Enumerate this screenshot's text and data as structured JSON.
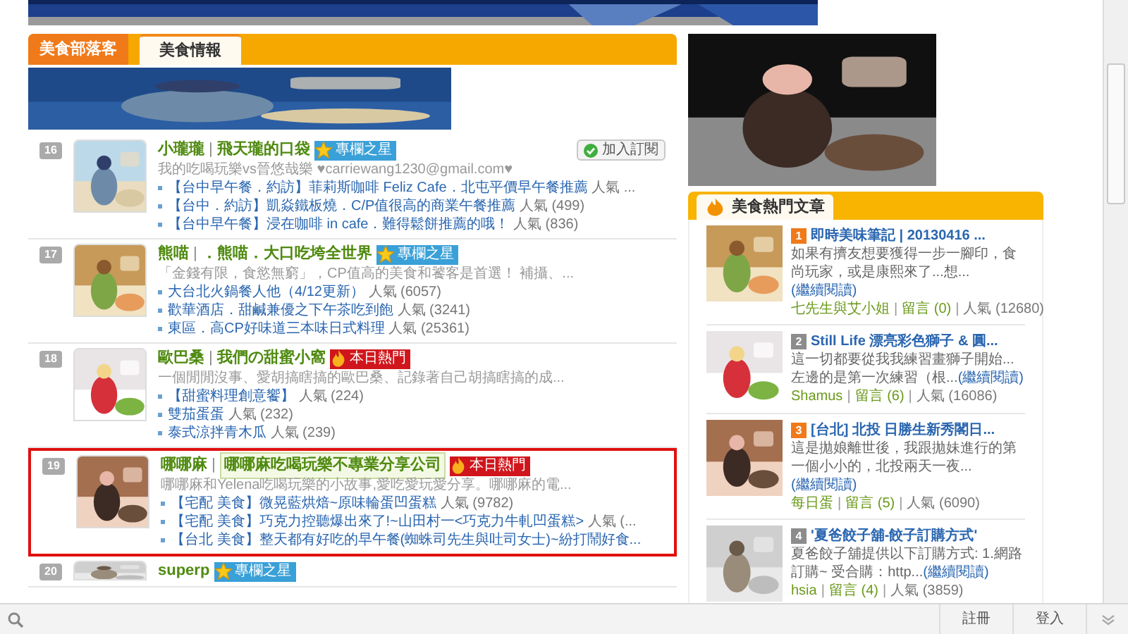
{
  "tabs": [
    {
      "label": "美食部落客",
      "selected": false
    },
    {
      "label": "美食情報",
      "selected": true
    }
  ],
  "blogs": [
    {
      "number": "16",
      "author": "小瓏瓏",
      "blog_name": "飛天瓏的口袋",
      "badge": {
        "kind": "star",
        "label": "專欄之星"
      },
      "subscribe": "加入訂閱",
      "highlighted": false,
      "description": "我的吃喝玩樂vs晉悠哉樂 ♥carriewang1230@gmail.com♥",
      "posts": [
        {
          "title": "【台中早午餐．約訪】菲莉斯咖啡 Feliz Cafe．北屯平價早午餐推薦",
          "popularity": "人氣 ..."
        },
        {
          "title": "【台中．約訪】凱焱鐵板燒．C/P值很高的商業午餐推薦",
          "popularity": "人氣 (499)"
        },
        {
          "title": "【台中早午餐】浸在咖啡 in cafe．難得鬆餅推薦的哦！",
          "popularity": "人氣 (836)"
        }
      ]
    },
    {
      "number": "17",
      "author": "熊喵",
      "blog_name": "．熊喵．大口吃垮全世界",
      "badge": {
        "kind": "star",
        "label": "專欄之星"
      },
      "highlighted": false,
      "description": "「金錢有限，食慾無窮」，CP值高的美食和饕客是首選！ 補攝、...",
      "posts": [
        {
          "title": "大台北火鍋餐人他（4/12更新）",
          "popularity": "人氣 (6057)"
        },
        {
          "title": "歡華酒店．甜鹹兼優之下午茶吃到飽",
          "popularity": "人氣 (3241)"
        },
        {
          "title": "東區．高CP好味道三本味日式料理",
          "popularity": "人氣 (25361)"
        }
      ]
    },
    {
      "number": "18",
      "author": "歐巴桑",
      "blog_name": "我們の甜蜜小窩",
      "badge": {
        "kind": "hot",
        "label": "本日熱門"
      },
      "highlighted": false,
      "description": "一個閒閒沒事、愛胡搞瞎搞的歐巴桑、記錄著自己胡搞瞎搞的成...",
      "posts": [
        {
          "title": "【甜蜜料理創意饗】",
          "popularity": "人氣 (224)"
        },
        {
          "title": "雙茄蛋蛋",
          "popularity": "人氣 (232)"
        },
        {
          "title": "泰式涼拌青木瓜",
          "popularity": "人氣 (239)"
        }
      ]
    },
    {
      "number": "19",
      "author": "哪哪麻",
      "blog_name": "哪哪麻吃喝玩樂不專業分享公司",
      "badge": {
        "kind": "hot",
        "label": "本日熱門"
      },
      "highlighted": true,
      "description": "哪哪麻和Yelena吃喝玩樂的小故事,愛吃愛玩愛分享。哪哪麻的電...",
      "posts": [
        {
          "title": "【宅配 美食】微晃藍烘焙~原味輪蛋凹蛋糕",
          "popularity": "人氣 (9782)"
        },
        {
          "title": "【宅配 美食】巧克力控聽爆出來了!~山田村一<巧克力牛軋凹蛋糕>",
          "popularity": "人氣 (..."
        },
        {
          "title": "【台北 美食】整天都有好吃的早午餐(蜘蛛司先生與吐司女士)~紛打鬧好食..."
        }
      ]
    },
    {
      "number": "20",
      "author": "superp",
      "badge": {
        "kind": "star",
        "label": "專欄之星"
      },
      "highlighted": false
    }
  ],
  "hot_articles": {
    "title": "美食熱門文章",
    "items": [
      {
        "rank": "1",
        "color": "#f07a1a",
        "title": "即時美味筆記 | 20130416 ...",
        "excerpt": "如果有擠友想要獲得一步一腳印，食尚玩家，或是康熙來了...想...",
        "read_more": "(繼續閱讀)",
        "author": "七先生與艾小姐",
        "comments": "留言 (0)",
        "popularity": "人氣 (12680)"
      },
      {
        "rank": "2",
        "color": "#8c8c8c",
        "title": "Still Life 漂亮彩色獅子 & 圓...",
        "excerpt": "這一切都要從我我練習畫獅子開始... 左邊的是第一次練習（根...",
        "read_more": "(繼續閱讀)",
        "author": "Shamus",
        "comments": "留言 (6)",
        "popularity": "人氣 (16086)"
      },
      {
        "rank": "3",
        "color": "#f07a1a",
        "title": "[台北] 北投 日勝生新秀閣日...",
        "excerpt": "這是拋娘離世後，我跟拋妹進行的第一個小小的，北投兩天一夜...",
        "read_more": "(繼續閱讀)",
        "author": "每日蛋",
        "comments": "留言 (5)",
        "popularity": "人氣 (6090)"
      },
      {
        "rank": "4",
        "color": "#8c8c8c",
        "title": "'夏爸餃子舖-餃子訂購方式'",
        "excerpt": "夏爸餃子舖提供以下訂購方式: 1.網路訂購~ 受合購：http...",
        "read_more": "(繼續閱讀)",
        "author": "hsia",
        "comments": "留言 (4)",
        "popularity": "人氣 (3859)"
      }
    ]
  },
  "bottom_bar": {
    "buttons": [
      "註冊",
      "登入"
    ]
  },
  "separator": "|"
}
